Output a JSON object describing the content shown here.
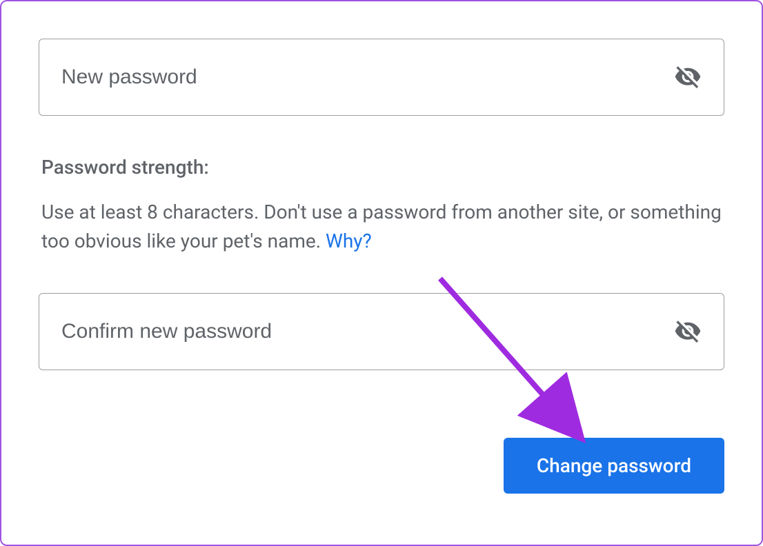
{
  "new_password": {
    "placeholder": "New password",
    "value": ""
  },
  "confirm_password": {
    "placeholder": "Confirm new password",
    "value": ""
  },
  "strength": {
    "label": "Password strength:",
    "description": "Use at least 8 characters. Don't use a password from another site, or something too obvious like your pet's name. ",
    "why_link": "Why?"
  },
  "submit_label": "Change password",
  "icons": {
    "visibility_off": "visibility-off-icon"
  }
}
